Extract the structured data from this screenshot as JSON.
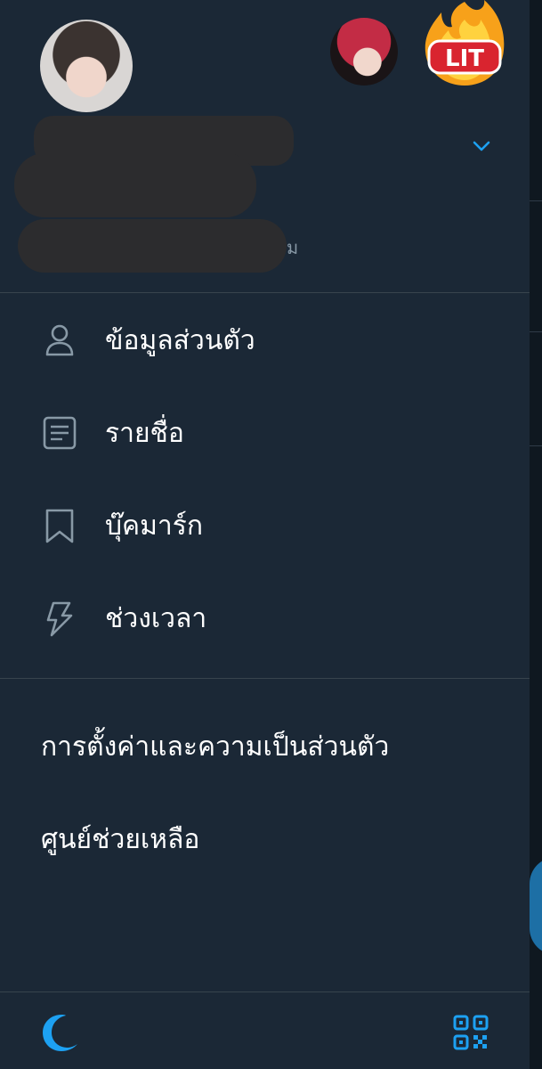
{
  "header": {
    "follow_suffix": "ม"
  },
  "menu": {
    "items": [
      {
        "label": "ข้อมูลส่วนตัว",
        "icon": "person-icon"
      },
      {
        "label": "รายชื่อ",
        "icon": "list-icon"
      },
      {
        "label": "บุ๊คมาร์ก",
        "icon": "bookmark-icon"
      },
      {
        "label": "ช่วงเวลา",
        "icon": "lightning-icon"
      }
    ]
  },
  "secondary": {
    "settings_label": "การตั้งค่าและความเป็นส่วนตัว",
    "help_label": "ศูนย์ช่วยเหลือ"
  },
  "badge": {
    "text": "LIT"
  },
  "colors": {
    "background": "#1b2836",
    "accent": "#1da1f2",
    "icon_muted": "#8899a6",
    "divider": "#38444d",
    "text": "#ffffff"
  }
}
